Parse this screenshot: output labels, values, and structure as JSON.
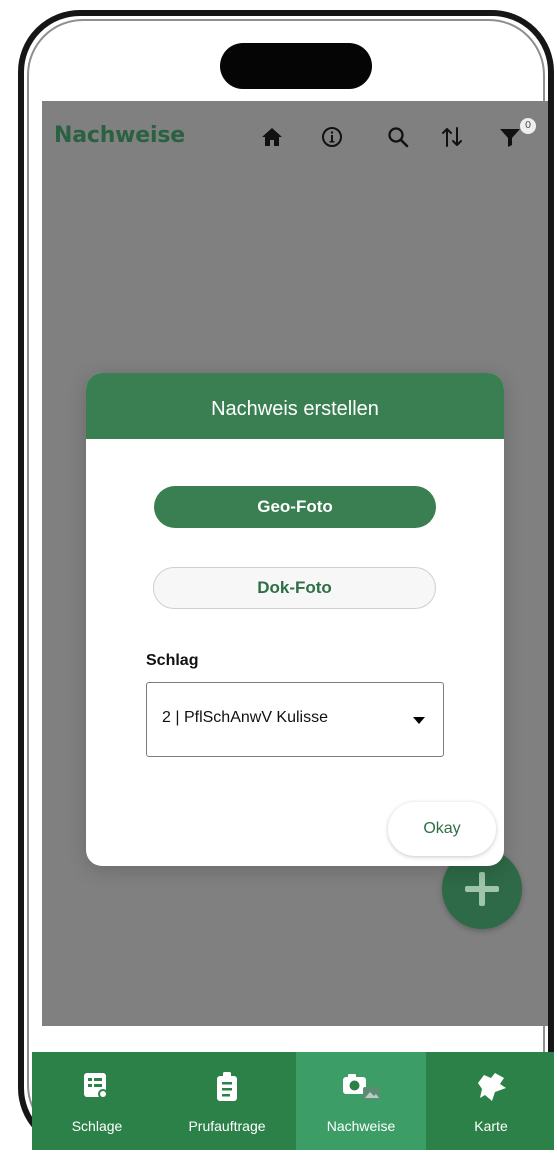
{
  "app": {
    "title": "Nachweise",
    "filter_count": "0"
  },
  "toolbar": {
    "icons": [
      "home-icon",
      "info-icon",
      "search-icon",
      "sort-icon",
      "filter-icon"
    ]
  },
  "dialog": {
    "title": "Nachweis erstellen",
    "buttons": {
      "geo": "Geo-Foto",
      "dok": "Dok-Foto",
      "okay": "Okay"
    },
    "field_label": "Schlag",
    "select_value": "2 | PflSchAnwV Kulisse"
  },
  "bottom_nav": {
    "items": [
      {
        "label": "Schlage",
        "icon": "fields-icon"
      },
      {
        "label": "Prufauftrage",
        "icon": "clipboard-icon"
      },
      {
        "label": "Nachweise",
        "icon": "camera-gallery-icon"
      },
      {
        "label": "Karte",
        "icon": "map-icon"
      }
    ]
  },
  "colors": {
    "primary": "#3a7f51",
    "app_title": "#2a6140",
    "overlay": "#808080",
    "nav": "#2b8148",
    "nav_active": "#3c9d66"
  }
}
